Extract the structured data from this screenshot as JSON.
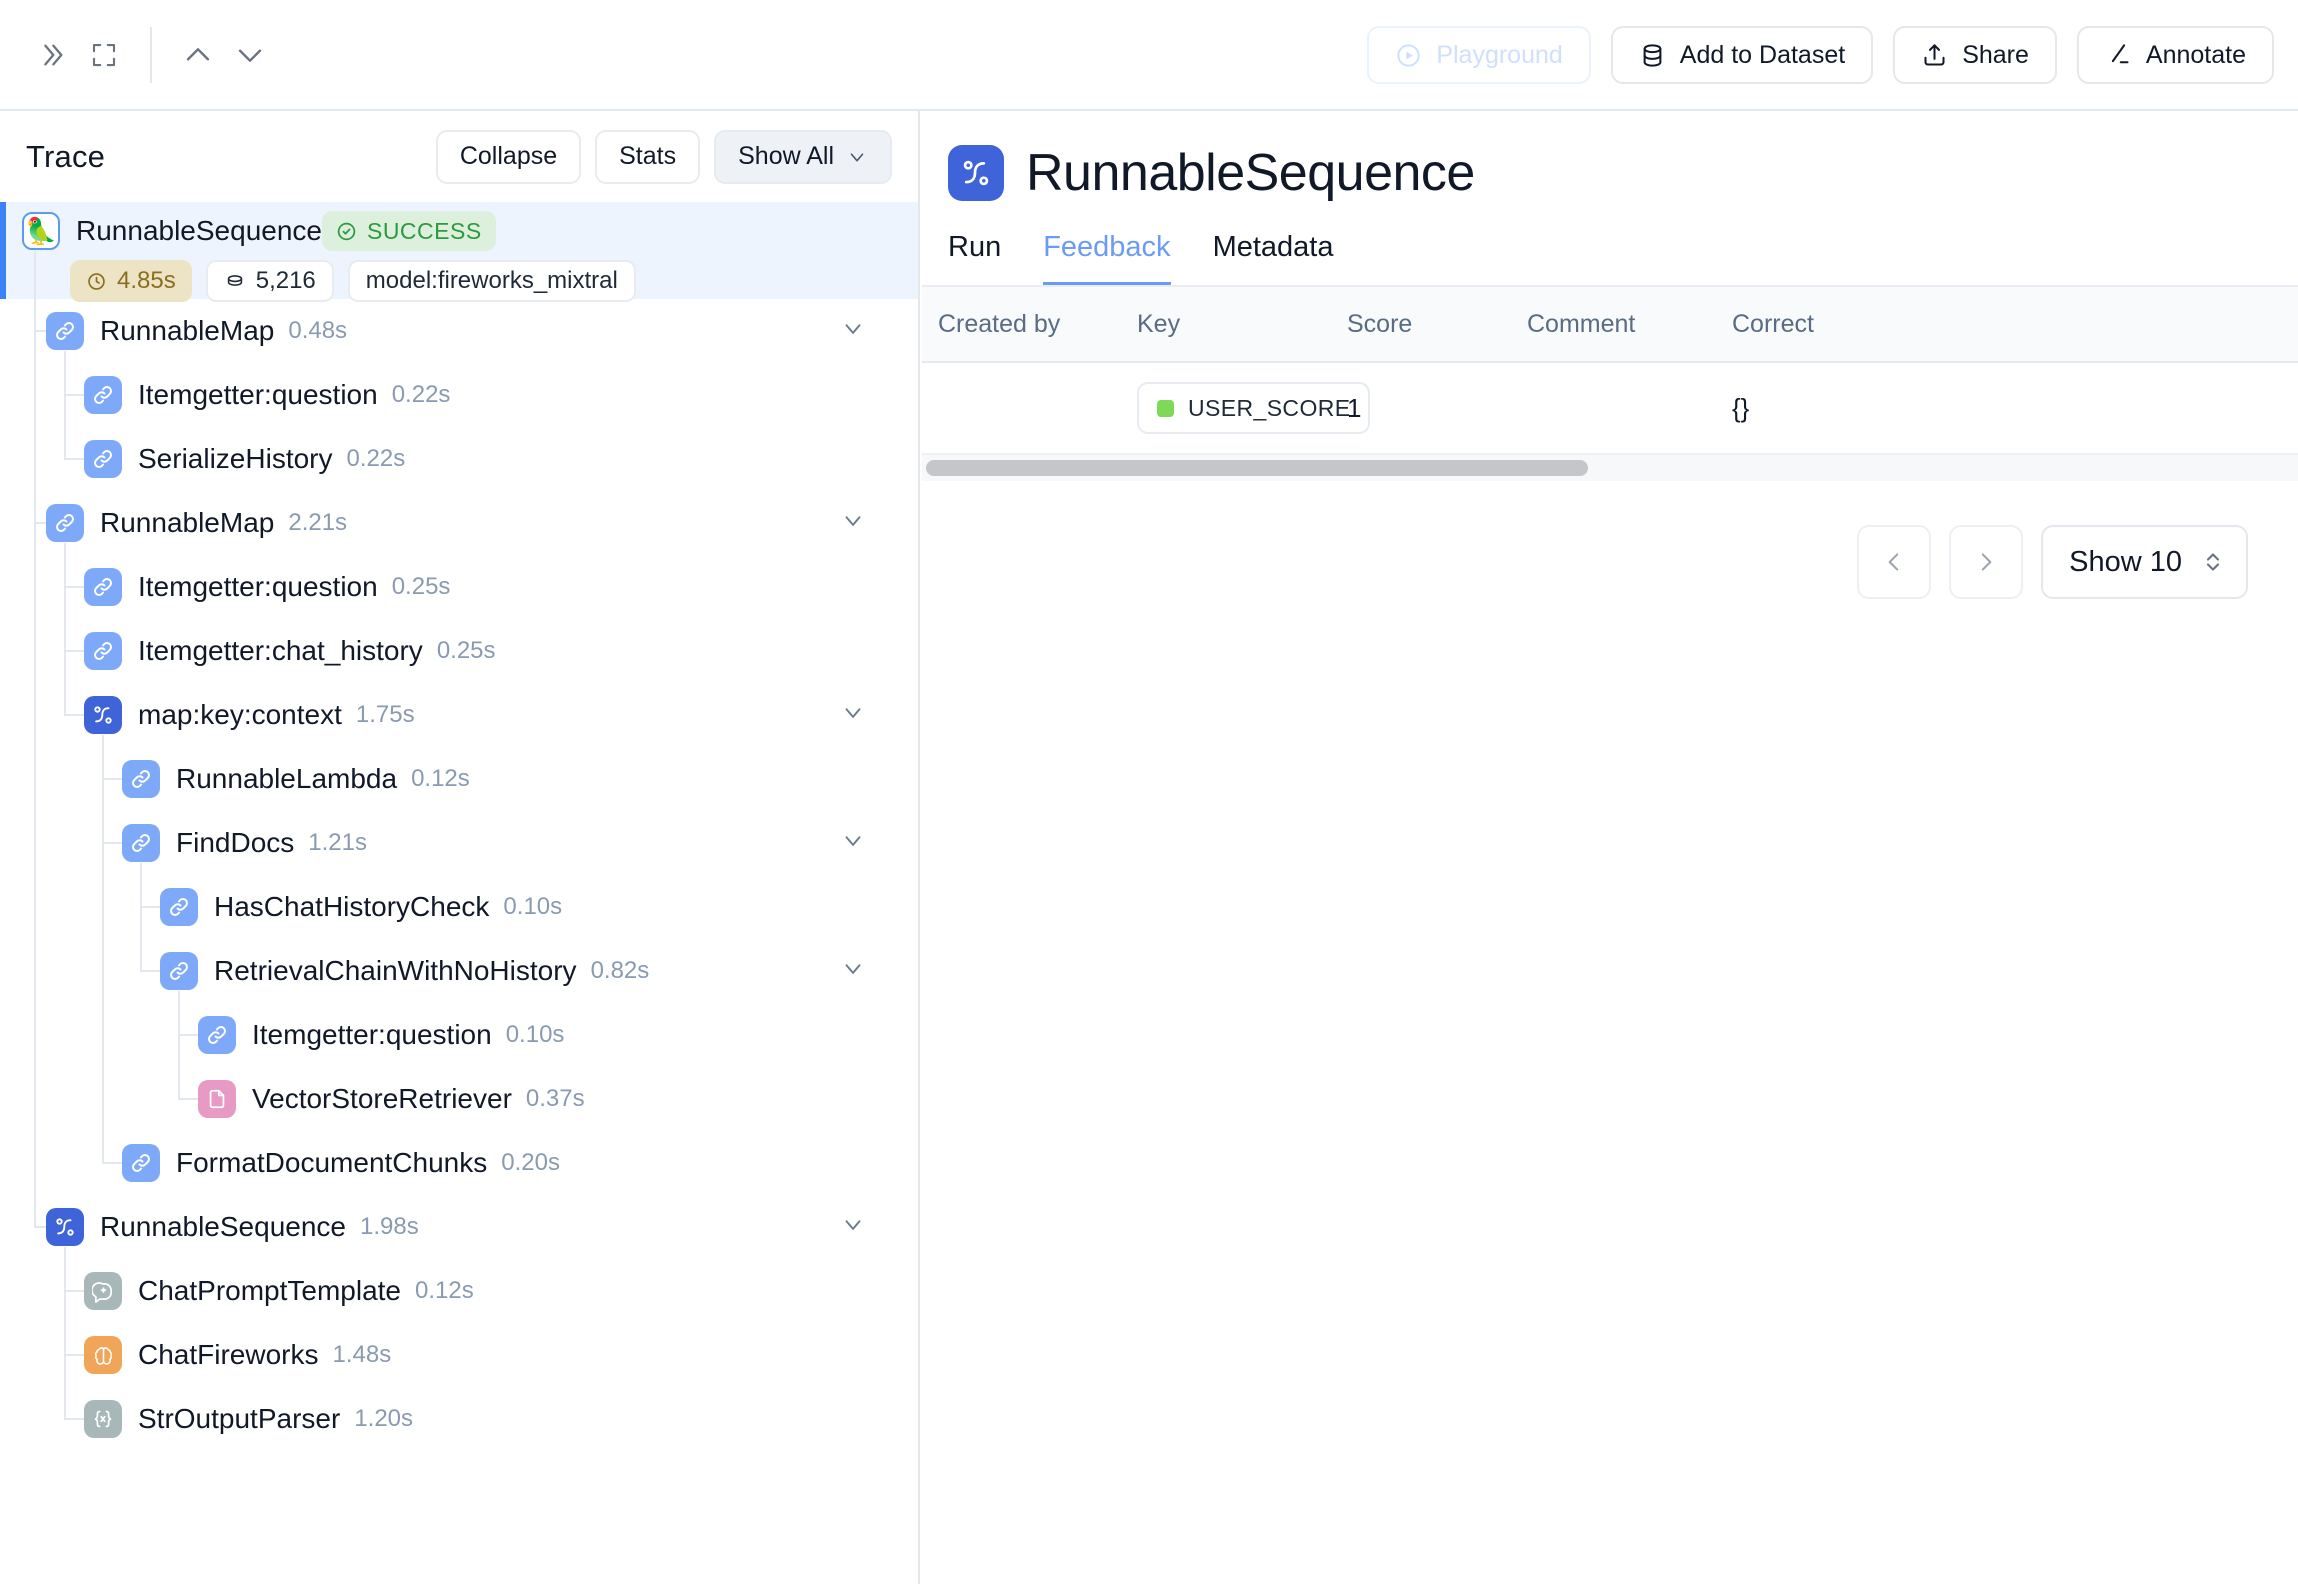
{
  "topbar": {
    "left_icons": [
      {
        "name": "expand-sidebar-icon",
        "glyph": "chevrons-right"
      },
      {
        "name": "fullscreen-icon",
        "glyph": "maximize"
      },
      {
        "name": "prev-run-icon",
        "glyph": "chevron-up"
      },
      {
        "name": "next-run-icon",
        "glyph": "chevron-down"
      }
    ],
    "buttons": [
      {
        "label": "Playground",
        "icon": "play-circle-icon",
        "disabled": true
      },
      {
        "label": "Add to Dataset",
        "icon": "database-icon",
        "disabled": false
      },
      {
        "label": "Share",
        "icon": "share-upload-icon",
        "disabled": false
      },
      {
        "label": "Annotate",
        "icon": "pencil-icon",
        "disabled": false
      }
    ]
  },
  "trace": {
    "title": "Trace",
    "collapse_label": "Collapse",
    "stats_label": "Stats",
    "show_all_label": "Show All",
    "root": {
      "label": "RunnableSequence",
      "status": "SUCCESS",
      "duration": "4.85s",
      "tokens": "5,216",
      "tag": "model:fireworks_mixtral",
      "icon": "parrot-icon"
    },
    "nodes": [
      {
        "label": "RunnableMap",
        "time": "0.48s",
        "depth": 1,
        "icon": "link-icon",
        "chevron": true
      },
      {
        "label": "Itemgetter:question",
        "time": "0.22s",
        "depth": 2,
        "icon": "link-icon",
        "chevron": false
      },
      {
        "label": "SerializeHistory",
        "time": "0.22s",
        "depth": 2,
        "icon": "link-icon",
        "chevron": false
      },
      {
        "label": "RunnableMap",
        "time": "2.21s",
        "depth": 1,
        "icon": "link-icon",
        "chevron": true
      },
      {
        "label": "Itemgetter:question",
        "time": "0.25s",
        "depth": 2,
        "icon": "link-icon",
        "chevron": false
      },
      {
        "label": "Itemgetter:chat_history",
        "time": "0.25s",
        "depth": 2,
        "icon": "link-icon",
        "chevron": false
      },
      {
        "label": "map:key:context",
        "time": "1.75s",
        "depth": 2,
        "icon": "sequence-icon",
        "chevron": true
      },
      {
        "label": "RunnableLambda",
        "time": "0.12s",
        "depth": 3,
        "icon": "link-icon",
        "chevron": false
      },
      {
        "label": "FindDocs",
        "time": "1.21s",
        "depth": 3,
        "icon": "link-icon",
        "chevron": true
      },
      {
        "label": "HasChatHistoryCheck",
        "time": "0.10s",
        "depth": 4,
        "icon": "link-icon",
        "chevron": false
      },
      {
        "label": "RetrievalChainWithNoHistory",
        "time": "0.82s",
        "depth": 4,
        "icon": "link-icon",
        "chevron": true
      },
      {
        "label": "Itemgetter:question",
        "time": "0.10s",
        "depth": 5,
        "icon": "link-icon",
        "chevron": false
      },
      {
        "label": "VectorStoreRetriever",
        "time": "0.37s",
        "depth": 5,
        "icon": "document-icon",
        "chevron": false
      },
      {
        "label": "FormatDocumentChunks",
        "time": "0.20s",
        "depth": 3,
        "icon": "link-icon",
        "chevron": false
      },
      {
        "label": "RunnableSequence",
        "time": "1.98s",
        "depth": 1,
        "icon": "sequence-icon",
        "chevron": true
      },
      {
        "label": "ChatPromptTemplate",
        "time": "0.12s",
        "depth": 2,
        "icon": "prompt-icon",
        "chevron": false
      },
      {
        "label": "ChatFireworks",
        "time": "1.48s",
        "depth": 2,
        "icon": "brain-icon",
        "chevron": false
      },
      {
        "label": "StrOutputParser",
        "time": "1.20s",
        "depth": 2,
        "icon": "parser-icon",
        "chevron": false
      }
    ]
  },
  "detail": {
    "title": "RunnableSequence",
    "title_icon": "sequence-icon",
    "tabs": [
      {
        "label": "Run",
        "active": false
      },
      {
        "label": "Feedback",
        "active": true
      },
      {
        "label": "Metadata",
        "active": false
      }
    ],
    "feedback_table": {
      "columns": [
        "Created by",
        "Key",
        "Score",
        "Comment",
        "Correct"
      ],
      "rows": [
        {
          "created_by": "",
          "key": "USER_SCORE",
          "key_dot_color": "#7ed957",
          "score": "1",
          "comment": "",
          "correct": "{}"
        }
      ]
    },
    "pagination": {
      "prev_icon": "chevron-left-icon",
      "next_icon": "chevron-right-icon",
      "page_size_label": "Show 10"
    }
  },
  "colors": {
    "accent": "#3b82f6",
    "tab_active": "#6b9bf5",
    "success": "#2e9a3e",
    "duration_badge_bg": "#ece4c5",
    "duration_badge_fg": "#8a6d1f",
    "selected_row_bg": "#eef4fd"
  }
}
